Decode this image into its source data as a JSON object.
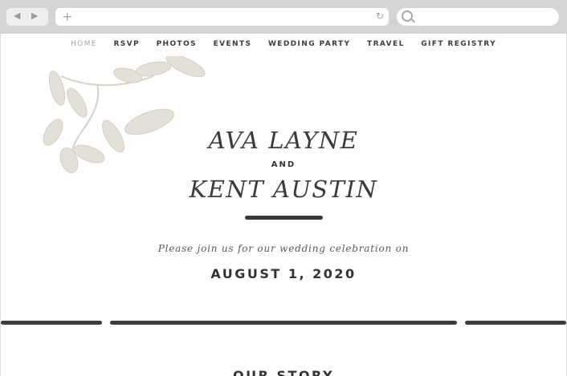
{
  "nav": {
    "items": [
      {
        "label": "HOME",
        "active": true
      },
      {
        "label": "RSVP"
      },
      {
        "label": "PHOTOS"
      },
      {
        "label": "EVENTS"
      },
      {
        "label": "WEDDING PARTY"
      },
      {
        "label": "TRAVEL"
      },
      {
        "label": "GIFT REGISTRY"
      }
    ]
  },
  "hero": {
    "name1": "AVA LAYNE",
    "and": "AND",
    "name2": "KENT AUSTIN",
    "invite": "Please join us for our wedding celebration on",
    "date": "AUGUST 1, 2020"
  },
  "sections": {
    "next_heading": "OUR STORY"
  },
  "icons": {
    "back": "back-arrow-icon",
    "forward": "forward-arrow-icon",
    "new_tab": "plus-icon",
    "reload": "reload-icon",
    "search": "search-icon",
    "decoration": "foliage-icon"
  },
  "colors": {
    "chrome": "#d4d4d4",
    "page_bg": "#ffffff",
    "text": "#3b3b3b",
    "foliage": "#e0ddd4"
  }
}
